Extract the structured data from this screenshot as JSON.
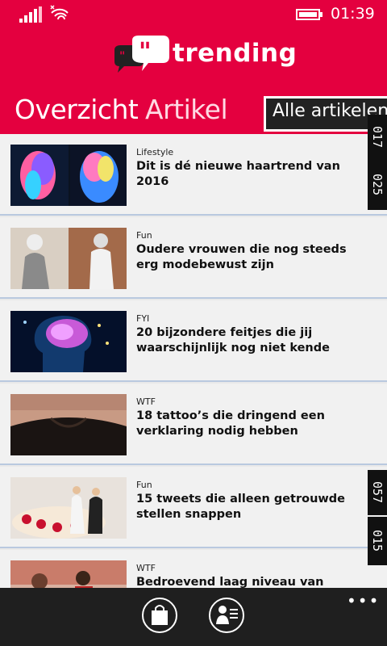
{
  "status": {
    "time": "01:39"
  },
  "brand": {
    "name": "trending"
  },
  "tabs": [
    {
      "label": "Overzicht"
    },
    {
      "label": "Artikel"
    },
    {
      "label": "Alle artikelen"
    }
  ],
  "articles": [
    {
      "category": "Lifestyle",
      "title": "Dit is dé nieuwe haartrend van 2016"
    },
    {
      "category": "Fun",
      "title": "Oudere vrouwen die nog steeds erg modebewust zijn"
    },
    {
      "category": "FYI",
      "title": "20 bijzondere feitjes die jij waarschijnlijk nog niet kende"
    },
    {
      "category": "WTF",
      "title": "18 tattoo’s die dringend een verklaring nodig hebben"
    },
    {
      "category": "Fun",
      "title": "15 tweets die alleen getrouwde stellen snappen"
    },
    {
      "category": "WTF",
      "title": "Bedroevend laag niveau van millennials"
    }
  ],
  "side_tags": [
    {
      "label": "017"
    },
    {
      "label": "025"
    },
    {
      "label": "057"
    },
    {
      "label": "015"
    }
  ],
  "appbar": {
    "more": "•••"
  },
  "colors": {
    "brand": "#e4003f",
    "appbar": "#1f1f1f"
  }
}
